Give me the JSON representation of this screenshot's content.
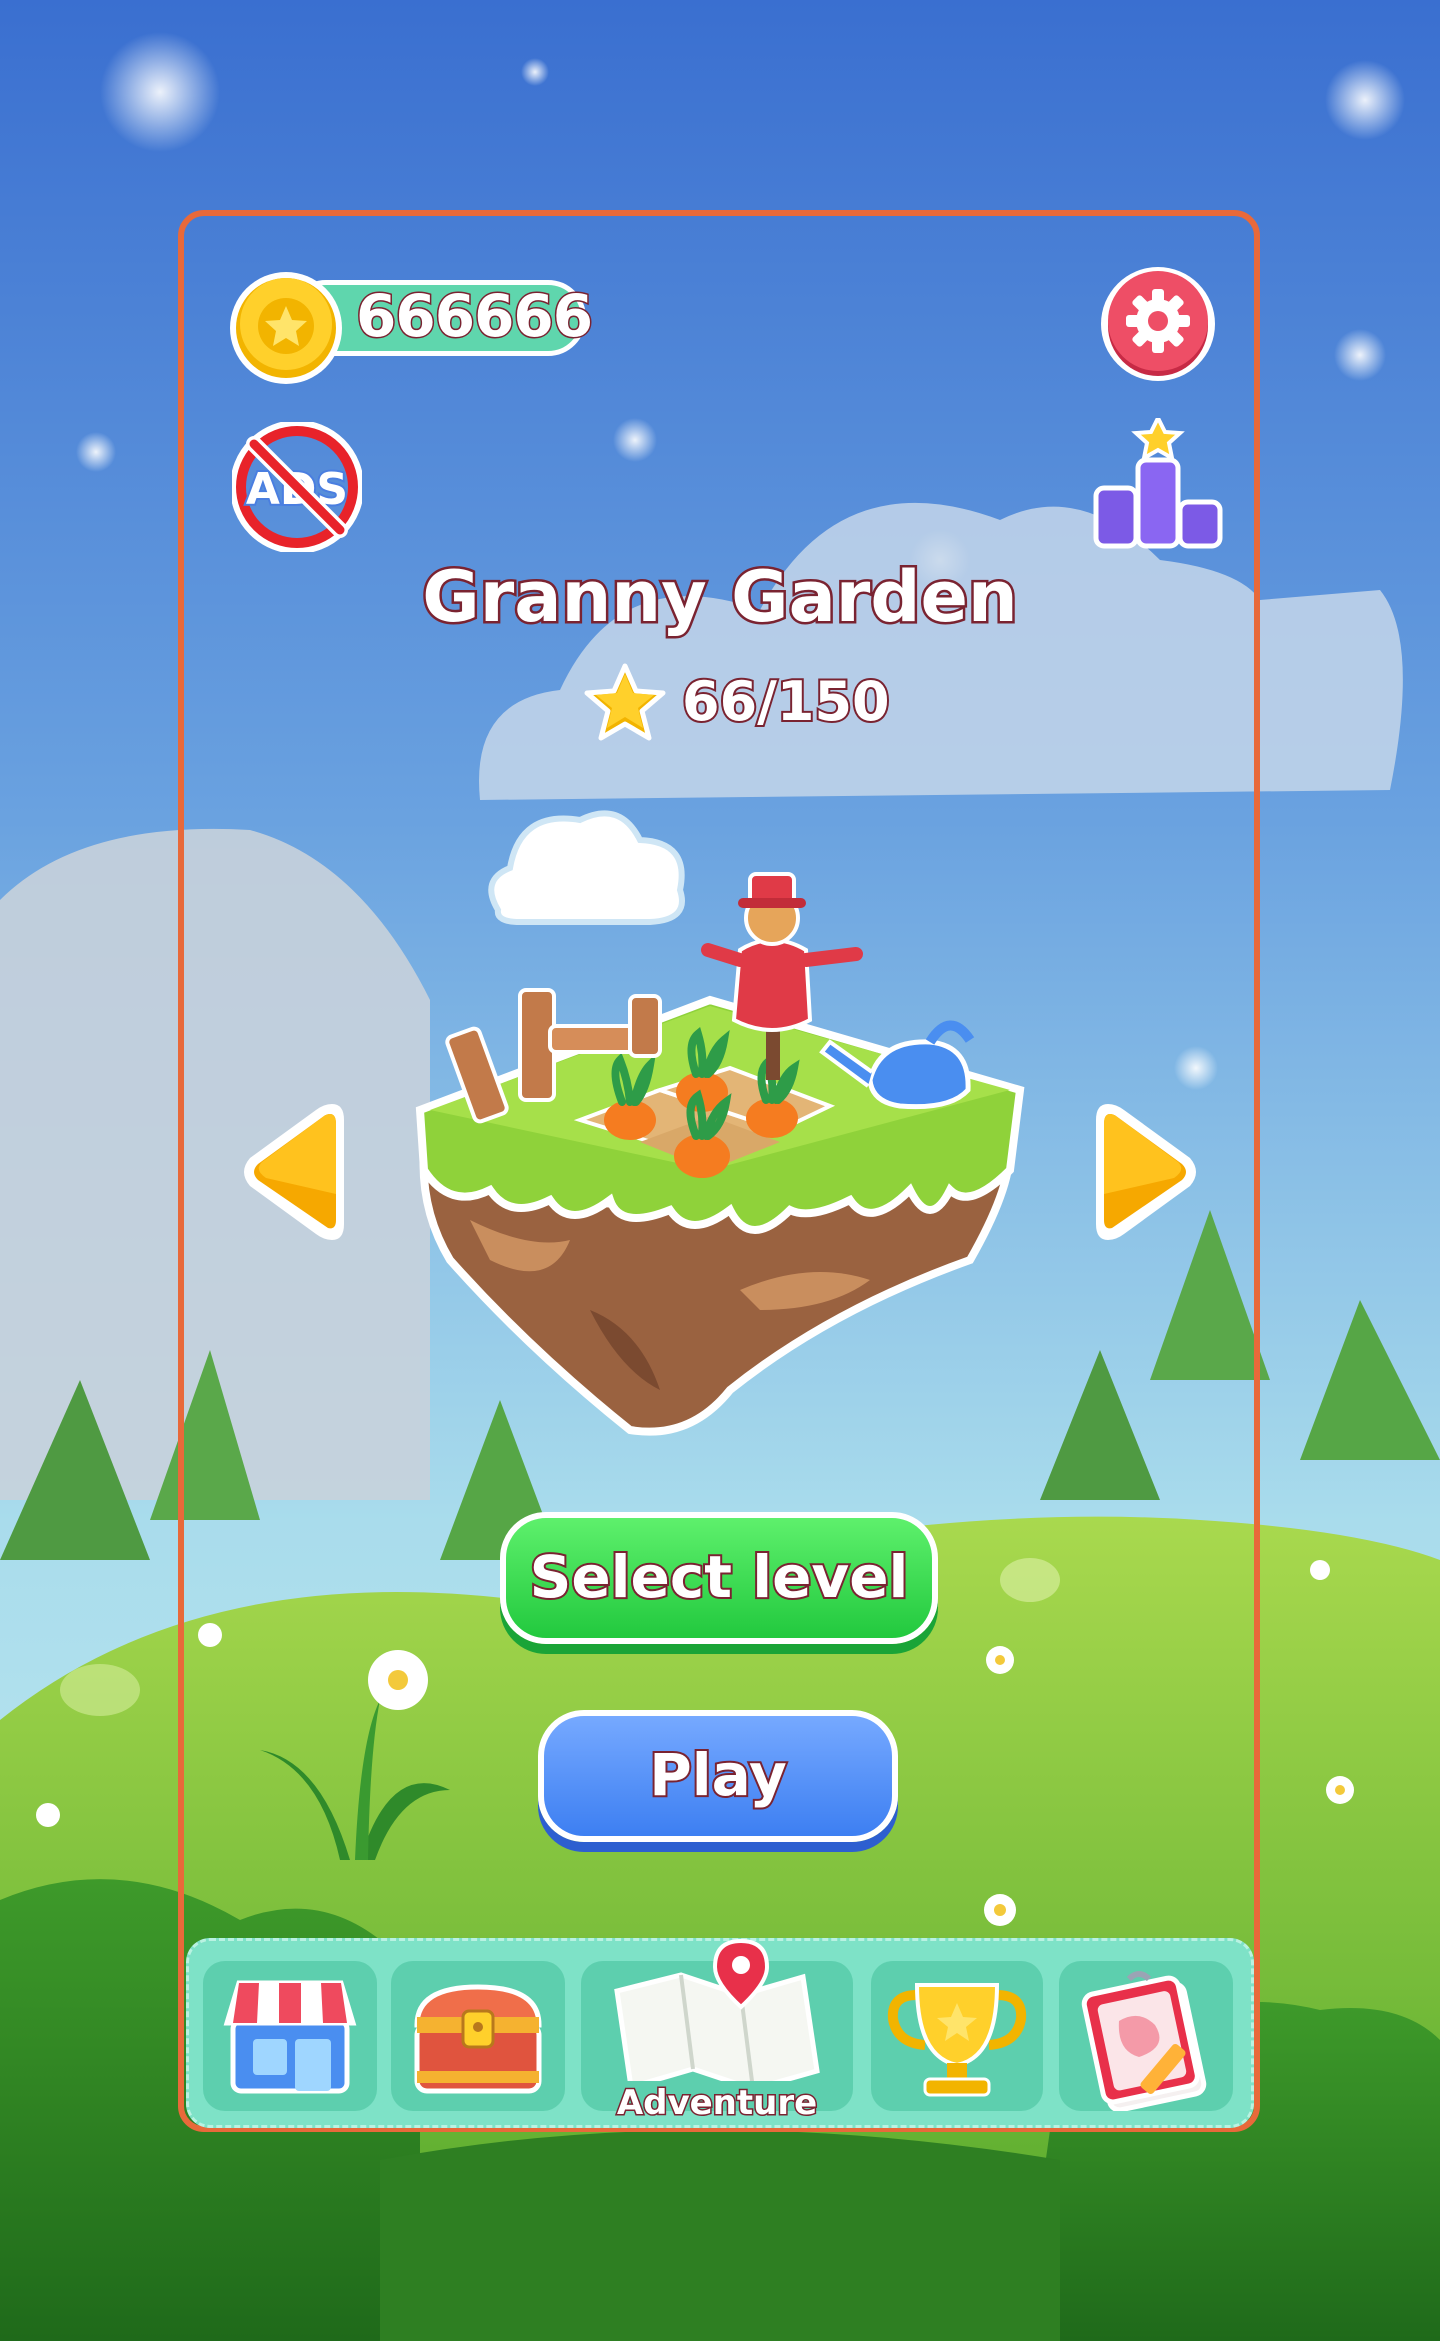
{
  "header": {
    "coins": "666666",
    "icons": {
      "coin": "coin-star-icon",
      "settings": "gear-icon",
      "no_ads": "no-ads-icon",
      "no_ads_text": "ADS",
      "leaderboard": "leaderboard-podium-icon"
    }
  },
  "level": {
    "title": "Granny Garden",
    "stars": "66/150",
    "star_icon": "star-icon"
  },
  "buttons": {
    "select_level": "Select level",
    "play": "Play"
  },
  "nav": {
    "items": [
      {
        "icon": "shop-icon",
        "label": ""
      },
      {
        "icon": "treasure-chest-icon",
        "label": ""
      },
      {
        "icon": "map-icon",
        "label": "Adventure",
        "active": true
      },
      {
        "icon": "trophy-icon",
        "label": ""
      },
      {
        "icon": "notebook-icon",
        "label": ""
      }
    ]
  },
  "colors": {
    "frame": "#e8693a",
    "coin_bar": "#5fd6ad",
    "select_green": "#22c93e",
    "play_blue": "#3d7ff2",
    "nav_bg": "#7ee2c7",
    "text_outline": "#7a2331"
  }
}
